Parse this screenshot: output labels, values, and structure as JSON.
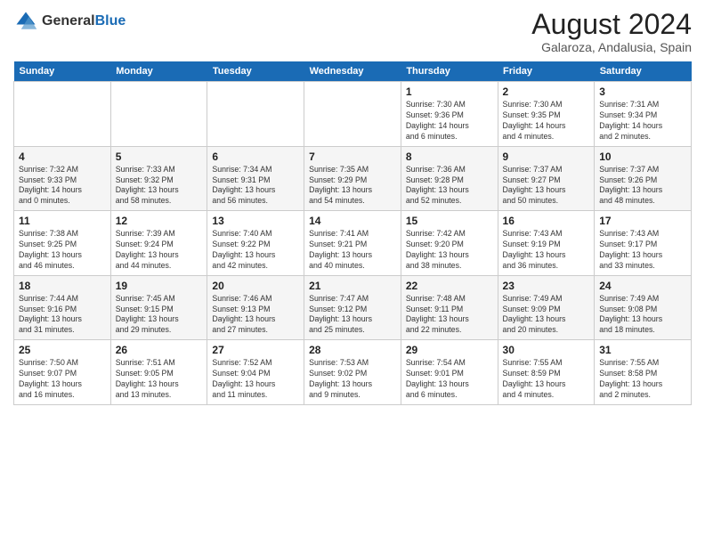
{
  "header": {
    "logo_line1": "General",
    "logo_line2": "Blue",
    "title": "August 2024",
    "subtitle": "Galaroza, Andalusia, Spain"
  },
  "weekdays": [
    "Sunday",
    "Monday",
    "Tuesday",
    "Wednesday",
    "Thursday",
    "Friday",
    "Saturday"
  ],
  "weeks": [
    [
      {
        "day": "",
        "content": ""
      },
      {
        "day": "",
        "content": ""
      },
      {
        "day": "",
        "content": ""
      },
      {
        "day": "",
        "content": ""
      },
      {
        "day": "1",
        "content": "Sunrise: 7:30 AM\nSunset: 9:36 PM\nDaylight: 14 hours\nand 6 minutes."
      },
      {
        "day": "2",
        "content": "Sunrise: 7:30 AM\nSunset: 9:35 PM\nDaylight: 14 hours\nand 4 minutes."
      },
      {
        "day": "3",
        "content": "Sunrise: 7:31 AM\nSunset: 9:34 PM\nDaylight: 14 hours\nand 2 minutes."
      }
    ],
    [
      {
        "day": "4",
        "content": "Sunrise: 7:32 AM\nSunset: 9:33 PM\nDaylight: 14 hours\nand 0 minutes."
      },
      {
        "day": "5",
        "content": "Sunrise: 7:33 AM\nSunset: 9:32 PM\nDaylight: 13 hours\nand 58 minutes."
      },
      {
        "day": "6",
        "content": "Sunrise: 7:34 AM\nSunset: 9:31 PM\nDaylight: 13 hours\nand 56 minutes."
      },
      {
        "day": "7",
        "content": "Sunrise: 7:35 AM\nSunset: 9:29 PM\nDaylight: 13 hours\nand 54 minutes."
      },
      {
        "day": "8",
        "content": "Sunrise: 7:36 AM\nSunset: 9:28 PM\nDaylight: 13 hours\nand 52 minutes."
      },
      {
        "day": "9",
        "content": "Sunrise: 7:37 AM\nSunset: 9:27 PM\nDaylight: 13 hours\nand 50 minutes."
      },
      {
        "day": "10",
        "content": "Sunrise: 7:37 AM\nSunset: 9:26 PM\nDaylight: 13 hours\nand 48 minutes."
      }
    ],
    [
      {
        "day": "11",
        "content": "Sunrise: 7:38 AM\nSunset: 9:25 PM\nDaylight: 13 hours\nand 46 minutes."
      },
      {
        "day": "12",
        "content": "Sunrise: 7:39 AM\nSunset: 9:24 PM\nDaylight: 13 hours\nand 44 minutes."
      },
      {
        "day": "13",
        "content": "Sunrise: 7:40 AM\nSunset: 9:22 PM\nDaylight: 13 hours\nand 42 minutes."
      },
      {
        "day": "14",
        "content": "Sunrise: 7:41 AM\nSunset: 9:21 PM\nDaylight: 13 hours\nand 40 minutes."
      },
      {
        "day": "15",
        "content": "Sunrise: 7:42 AM\nSunset: 9:20 PM\nDaylight: 13 hours\nand 38 minutes."
      },
      {
        "day": "16",
        "content": "Sunrise: 7:43 AM\nSunset: 9:19 PM\nDaylight: 13 hours\nand 36 minutes."
      },
      {
        "day": "17",
        "content": "Sunrise: 7:43 AM\nSunset: 9:17 PM\nDaylight: 13 hours\nand 33 minutes."
      }
    ],
    [
      {
        "day": "18",
        "content": "Sunrise: 7:44 AM\nSunset: 9:16 PM\nDaylight: 13 hours\nand 31 minutes."
      },
      {
        "day": "19",
        "content": "Sunrise: 7:45 AM\nSunset: 9:15 PM\nDaylight: 13 hours\nand 29 minutes."
      },
      {
        "day": "20",
        "content": "Sunrise: 7:46 AM\nSunset: 9:13 PM\nDaylight: 13 hours\nand 27 minutes."
      },
      {
        "day": "21",
        "content": "Sunrise: 7:47 AM\nSunset: 9:12 PM\nDaylight: 13 hours\nand 25 minutes."
      },
      {
        "day": "22",
        "content": "Sunrise: 7:48 AM\nSunset: 9:11 PM\nDaylight: 13 hours\nand 22 minutes."
      },
      {
        "day": "23",
        "content": "Sunrise: 7:49 AM\nSunset: 9:09 PM\nDaylight: 13 hours\nand 20 minutes."
      },
      {
        "day": "24",
        "content": "Sunrise: 7:49 AM\nSunset: 9:08 PM\nDaylight: 13 hours\nand 18 minutes."
      }
    ],
    [
      {
        "day": "25",
        "content": "Sunrise: 7:50 AM\nSunset: 9:07 PM\nDaylight: 13 hours\nand 16 minutes."
      },
      {
        "day": "26",
        "content": "Sunrise: 7:51 AM\nSunset: 9:05 PM\nDaylight: 13 hours\nand 13 minutes."
      },
      {
        "day": "27",
        "content": "Sunrise: 7:52 AM\nSunset: 9:04 PM\nDaylight: 13 hours\nand 11 minutes."
      },
      {
        "day": "28",
        "content": "Sunrise: 7:53 AM\nSunset: 9:02 PM\nDaylight: 13 hours\nand 9 minutes."
      },
      {
        "day": "29",
        "content": "Sunrise: 7:54 AM\nSunset: 9:01 PM\nDaylight: 13 hours\nand 6 minutes."
      },
      {
        "day": "30",
        "content": "Sunrise: 7:55 AM\nSunset: 8:59 PM\nDaylight: 13 hours\nand 4 minutes."
      },
      {
        "day": "31",
        "content": "Sunrise: 7:55 AM\nSunset: 8:58 PM\nDaylight: 13 hours\nand 2 minutes."
      }
    ]
  ]
}
